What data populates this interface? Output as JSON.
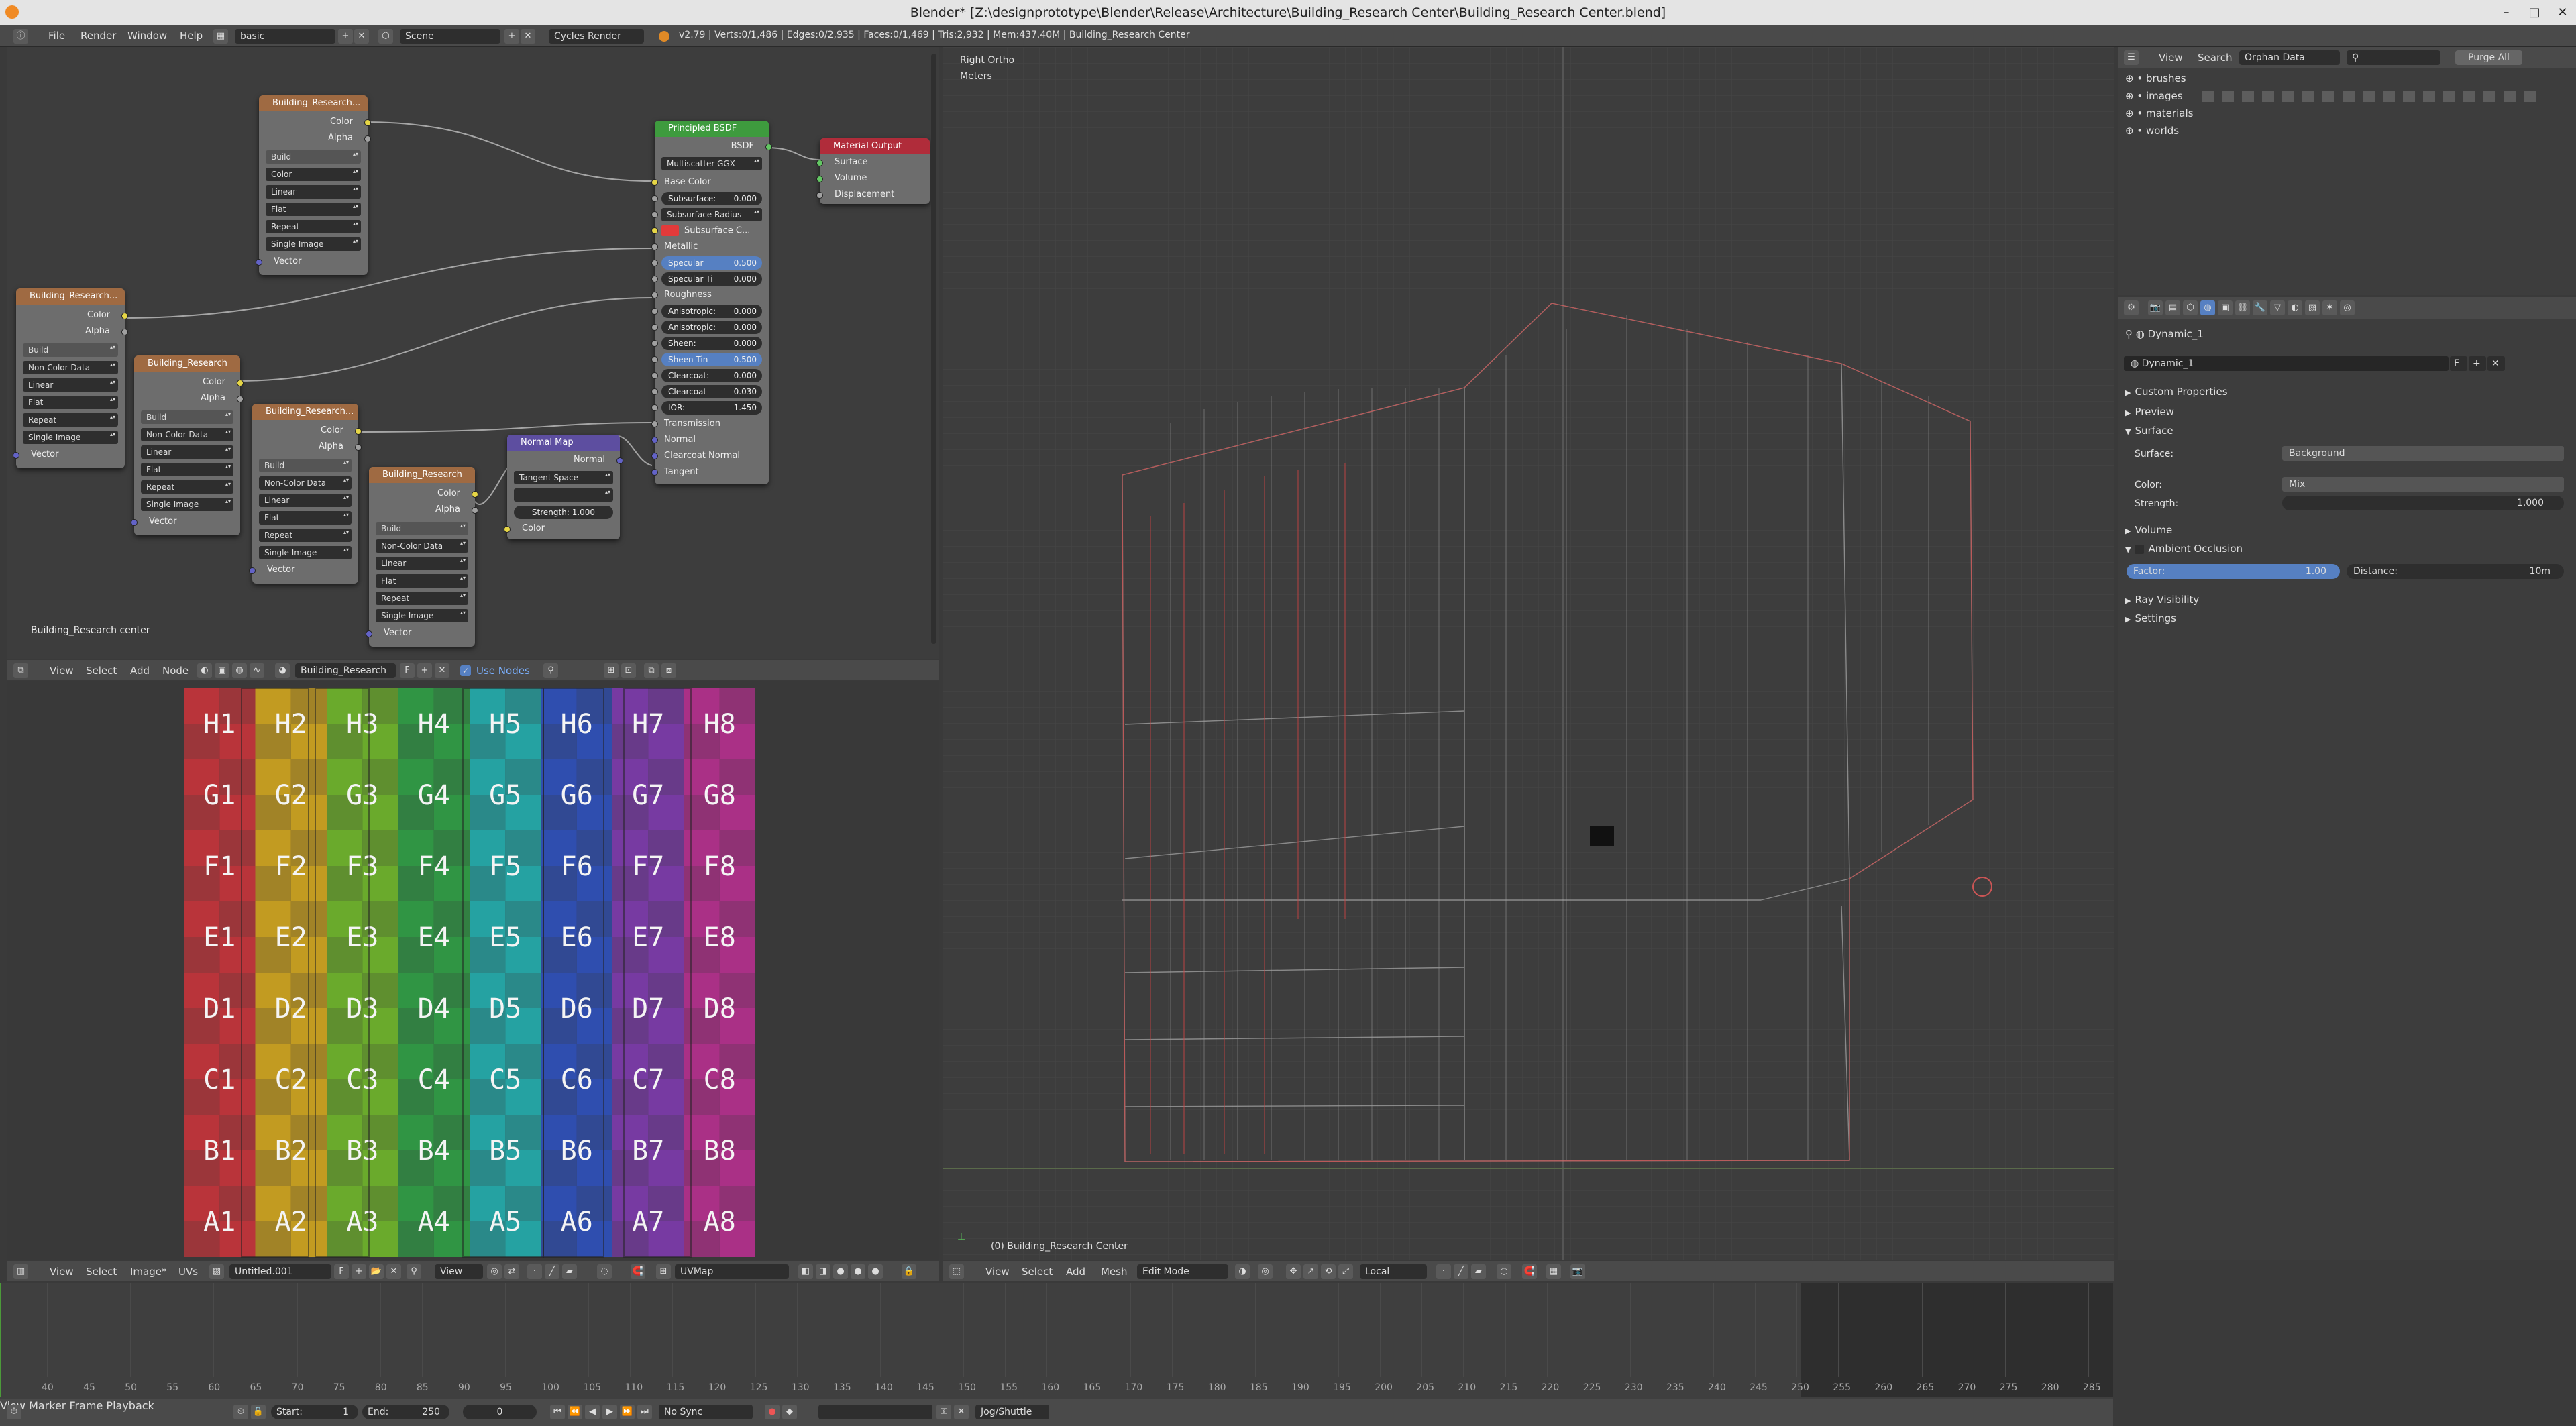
{
  "window": {
    "title": "Blender* [Z:\\designprototype\\Blender\\Release\\Architecture\\Building_Research Center\\Building_Research Center.blend]",
    "controls": [
      "–",
      "□",
      "✕"
    ]
  },
  "topbar": {
    "menus": [
      "File",
      "Render",
      "Window",
      "Help"
    ],
    "layout": "basic",
    "scene": "Scene",
    "engine": "Cycles Render",
    "stats": "v2.79 | Verts:0/1,486 | Edges:0/2,935 | Faces:0/1,469 | Tris:2,932 | Mem:437.40M | Building_Research Center"
  },
  "node_editor": {
    "footer_label": "Building_Research center",
    "header": {
      "menus": [
        "View",
        "Select",
        "Add",
        "Node"
      ],
      "material": "Building_Research ...",
      "fake_user": "F",
      "use_nodes": "Use Nodes"
    },
    "tex_nodes": [
      {
        "title": "Building_Research...",
        "outputs": [
          "Color",
          "Alpha"
        ],
        "img": "Build",
        "options": [
          "Color",
          "Linear",
          "Flat",
          "Repeat",
          "Single Image"
        ],
        "input": "Vector"
      },
      {
        "title": "Building_Research...",
        "outputs": [
          "Color",
          "Alpha"
        ],
        "img": "Build",
        "options": [
          "Non-Color Data",
          "Linear",
          "Flat",
          "Repeat",
          "Single Image"
        ],
        "input": "Vector"
      },
      {
        "title": "Building_Research",
        "outputs": [
          "Color",
          "Alpha"
        ],
        "img": "Build",
        "options": [
          "Non-Color Data",
          "Linear",
          "Flat",
          "Repeat",
          "Single Image"
        ],
        "input": "Vector"
      },
      {
        "title": "Building_Research...",
        "outputs": [
          "Color",
          "Alpha"
        ],
        "img": "Build",
        "options": [
          "Non-Color Data",
          "Linear",
          "Flat",
          "Repeat",
          "Single Image"
        ],
        "input": "Vector"
      },
      {
        "title": "Building_Research",
        "outputs": [
          "Color",
          "Alpha"
        ],
        "img": "Build",
        "options": [
          "Non-Color Data",
          "Linear",
          "Flat",
          "Repeat",
          "Single Image"
        ],
        "input": "Vector"
      }
    ],
    "principled": {
      "title": "Principled BSDF",
      "output": "BSDF",
      "distribution": "Multiscatter GGX",
      "rows": [
        {
          "label": "Base Color",
          "kind": "socket"
        },
        {
          "label": "Subsurface:",
          "value": "0.000",
          "kind": "slider"
        },
        {
          "label": "Subsurface Radius",
          "kind": "select"
        },
        {
          "label": "Subsurface C...",
          "kind": "color"
        },
        {
          "label": "Metallic",
          "kind": "socket"
        },
        {
          "label": "Specular",
          "value": "0.500",
          "kind": "blue"
        },
        {
          "label": "Specular Ti",
          "value": "0.000",
          "kind": "slider"
        },
        {
          "label": "Roughness",
          "kind": "socket"
        },
        {
          "label": "Anisotropic:",
          "value": "0.000",
          "kind": "slider"
        },
        {
          "label": "Anisotropic:",
          "value": "0.000",
          "kind": "slider"
        },
        {
          "label": "Sheen:",
          "value": "0.000",
          "kind": "slider"
        },
        {
          "label": "Sheen Tin",
          "value": "0.500",
          "kind": "blue"
        },
        {
          "label": "Clearcoat:",
          "value": "0.000",
          "kind": "slider"
        },
        {
          "label": "Clearcoat",
          "value": "0.030",
          "kind": "slider"
        },
        {
          "label": "IOR:",
          "value": "1.450",
          "kind": "slider"
        },
        {
          "label": "Transmission",
          "kind": "socket"
        },
        {
          "label": "Normal",
          "kind": "socket"
        },
        {
          "label": "Clearcoat Normal",
          "kind": "socket"
        },
        {
          "label": "Tangent",
          "kind": "socket"
        }
      ]
    },
    "material_output": {
      "title": "Material Output",
      "inputs": [
        "Surface",
        "Volume",
        "Displacement"
      ]
    },
    "normal_map": {
      "title": "Normal Map",
      "output": "Normal",
      "space": "Tangent Space",
      "strength": "Strength:",
      "strength_value": "1.000",
      "input": "Color"
    }
  },
  "uv_editor": {
    "rows": [
      "H",
      "G",
      "F",
      "E",
      "D",
      "C",
      "B",
      "A"
    ],
    "cols": [
      "1",
      "2",
      "3",
      "4",
      "5",
      "6",
      "7",
      "8"
    ],
    "header": {
      "menus": [
        "View",
        "Select",
        "Image*",
        "UVs"
      ],
      "image": "Untitled.001",
      "fake_user": "F",
      "view": "View",
      "uvmap": "UVMap"
    }
  },
  "viewport": {
    "overlay_view": "Right Ortho",
    "overlay_units": "Meters",
    "object_label": "(0) Building_Research Center",
    "header": {
      "menus": [
        "View",
        "Select",
        "Add",
        "Mesh"
      ],
      "mode": "Edit Mode",
      "pivot": "Local"
    }
  },
  "outliner": {
    "header": {
      "menus": [
        "View",
        "Search"
      ],
      "display": "Orphan Data",
      "purge": "Purge All"
    },
    "items": [
      "brushes",
      "images",
      "materials",
      "worlds"
    ]
  },
  "properties": {
    "breadcrumb": "Dynamic_1",
    "world_name": "Dynamic_1",
    "fake_user": "F",
    "sections": {
      "custom": "Custom Properties",
      "preview": "Preview",
      "surface": "Surface",
      "volume": "Volume",
      "ao": "Ambient Occlusion",
      "ray": "Ray Visibility",
      "settings": "Settings"
    },
    "surface_label": "Surface:",
    "surface_value": "Background",
    "color_label": "Color:",
    "color_value": "Mix",
    "strength_label": "Strength:",
    "strength_value": "1.000",
    "factor_label": "Factor:",
    "factor_value": "1.00",
    "distance_label": "Distance:",
    "distance_value": "10m"
  },
  "timeline": {
    "ticks": [
      "40",
      "45",
      "50",
      "55",
      "60",
      "65",
      "70",
      "75",
      "80",
      "85",
      "90",
      "95",
      "100",
      "105",
      "110",
      "115",
      "120",
      "125",
      "130",
      "135",
      "140",
      "145",
      "150",
      "155",
      "160",
      "165",
      "170",
      "175",
      "180",
      "185",
      "190",
      "195",
      "200",
      "205",
      "210",
      "215",
      "220",
      "225",
      "230",
      "235",
      "240",
      "245",
      "250",
      "255",
      "260",
      "265",
      "270",
      "275",
      "280",
      "285"
    ],
    "menus": [
      "View",
      "Marker",
      "Frame",
      "Playback"
    ],
    "start_label": "Start:",
    "start_value": "1",
    "end_label": "End:",
    "end_value": "250",
    "current": "0",
    "sync": "No Sync",
    "jog": "Jog/Shuttle"
  },
  "colors": {
    "uv_grid": [
      "#c0343a",
      "#c9a020",
      "#6db02b",
      "#2f9a45",
      "#24a8a8",
      "#2e4fb5",
      "#7a3aa8",
      "#b02f8a"
    ]
  }
}
